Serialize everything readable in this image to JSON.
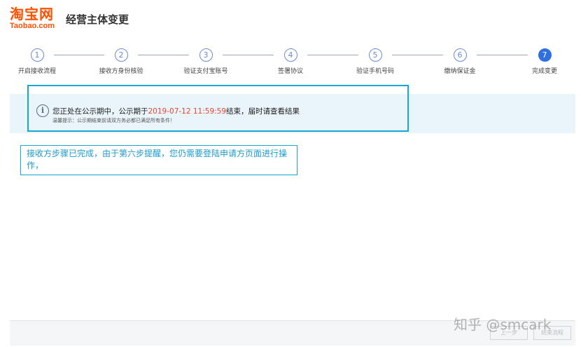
{
  "header": {
    "logo_cn": "淘宝网",
    "logo_en": "Taobao.com",
    "title": "经营主体变更"
  },
  "steps": [
    {
      "number": "1",
      "label": "开启接收流程",
      "active": false
    },
    {
      "number": "2",
      "label": "接收方身份核验",
      "active": false
    },
    {
      "number": "3",
      "label": "验证支付宝账号",
      "active": false
    },
    {
      "number": "4",
      "label": "签署协议",
      "active": false
    },
    {
      "number": "5",
      "label": "验证手机号码",
      "active": false
    },
    {
      "number": "6",
      "label": "缴纳保证金",
      "active": false
    },
    {
      "number": "7",
      "label": "完成变更",
      "active": true
    }
  ],
  "notice": {
    "icon": "info-icon",
    "text_before": "您正处在公示期中，公示期于",
    "date": "2019-07-12 11:59:59",
    "text_after": "结束，届时请查看结果",
    "tip": "温馨提示：公示期结束前请双方务必都已满足所有条件！"
  },
  "annotation": {
    "text": "接收方步骤已完成，由于第六步提醒，您仍需要登陆申请方页面进行操作，"
  },
  "footer": {
    "prev_label": "上一步",
    "end_label": "结束流程"
  },
  "watermark": "知乎 @smcark",
  "colors": {
    "brand": "#ff5000",
    "accent": "#2f6fe0",
    "highlight": "#e8452e",
    "annotation": "#1aa6d4"
  }
}
